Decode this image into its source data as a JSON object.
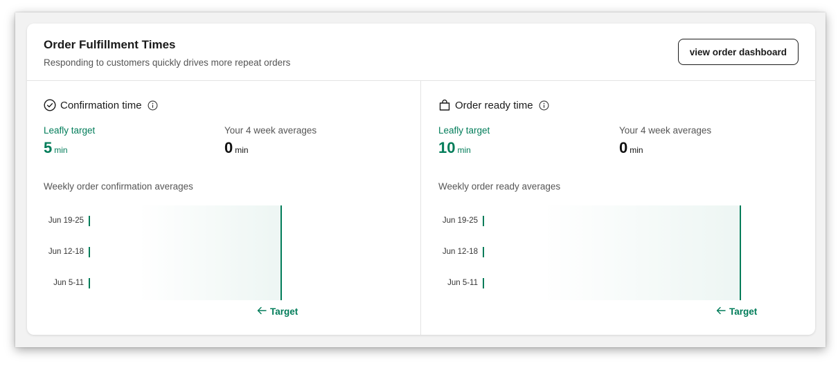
{
  "header": {
    "title": "Order Fulfillment Times",
    "subtitle": "Responding to customers quickly drives more repeat orders",
    "dashboard_button": "view order dashboard"
  },
  "panels": [
    {
      "title": "Confirmation time",
      "icon": "check-circle-icon",
      "target_label": "Leafly target",
      "target_value": "5",
      "target_unit": "min",
      "avg_label": "Your 4 week averages",
      "avg_value": "0",
      "avg_unit": "min",
      "section_label": "Weekly order confirmation averages",
      "target_marker": "Target",
      "target_minutes": 5,
      "weeks": [
        {
          "label": "Jun 19-25",
          "value": 0
        },
        {
          "label": "Jun 12-18",
          "value": 0
        },
        {
          "label": "Jun 5-11",
          "value": 0
        }
      ]
    },
    {
      "title": "Order ready time",
      "icon": "shopping-bag-icon",
      "target_label": "Leafly target",
      "target_value": "10",
      "target_unit": "min",
      "avg_label": "Your 4 week averages",
      "avg_value": "0",
      "avg_unit": "min",
      "section_label": "Weekly order ready averages",
      "target_marker": "Target",
      "target_minutes": 10,
      "weeks": [
        {
          "label": "Jun 19-25",
          "value": 0
        },
        {
          "label": "Jun 12-18",
          "value": 0
        },
        {
          "label": "Jun 5-11",
          "value": 0
        }
      ]
    }
  ],
  "colors": {
    "accent": "#017c59",
    "text": "#1a1a1a",
    "muted": "#555555",
    "border": "#e3e3e3"
  }
}
